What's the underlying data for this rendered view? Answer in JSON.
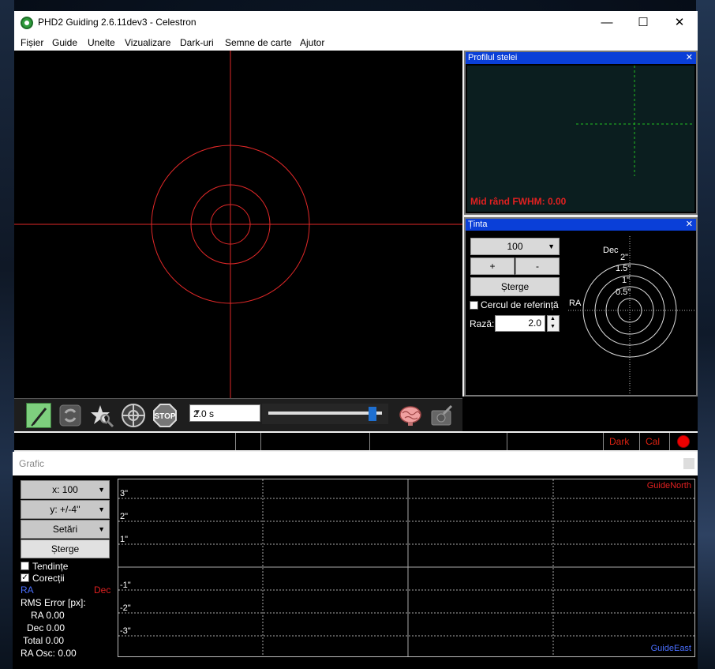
{
  "window": {
    "title": "PHD2 Guiding 2.6.11dev3 - Celestron",
    "minimize": "—",
    "maximize": "☐",
    "close": "✕"
  },
  "menu": {
    "items": [
      "Fișier",
      "Guide",
      "Unelte",
      "Vizualizare",
      "Dark-uri",
      "Semne de carte",
      "Ajutor"
    ]
  },
  "toolbar": {
    "exposure": "2.0 s",
    "icons": [
      "connect-icon",
      "loop-icon",
      "autoselect-star-icon",
      "guide-icon",
      "stop-icon",
      "brain-icon",
      "tools-icon"
    ],
    "gamma_fraction": 0.92
  },
  "status": {
    "dark": "Dark",
    "cal": "Cal"
  },
  "star_profile": {
    "title": "Profilul stelei",
    "close": "✕",
    "fwhm": "Mid rând FWHM: 0.00"
  },
  "target": {
    "title": "Ținta",
    "close": "✕",
    "length": "100",
    "zoom_in": "+",
    "zoom_out": "-",
    "clear": "Șterge",
    "ref_circle": "Cercul de referință",
    "radius_label": "Rază:",
    "radius_value": "2.0",
    "axis_dec": "Dec",
    "axis_ra": "RA",
    "rings": [
      "2\"",
      "1.5\"",
      "1\"",
      "0.5\""
    ]
  },
  "graph": {
    "title": "Grafic",
    "x_select": "x: 100",
    "y_select": "y: +/-4''",
    "settings": "Setări",
    "clear": "Șterge",
    "trends": "Tendințe",
    "corrections": "Corecții",
    "ra_legend": "RA",
    "dec_legend": "Dec",
    "rms_title": "RMS Error [px]:",
    "ra_rms": "RA 0.00",
    "dec_rms": "Dec 0.00",
    "total_rms": "Total 0.00",
    "ra_osc": "RA Osc: 0.00",
    "guide_north": "GuideNorth",
    "guide_east": "GuideEast",
    "y_ticks": [
      "3\"",
      "2\"",
      "1\"",
      "-1\"",
      "-2\"",
      "-3\""
    ]
  }
}
